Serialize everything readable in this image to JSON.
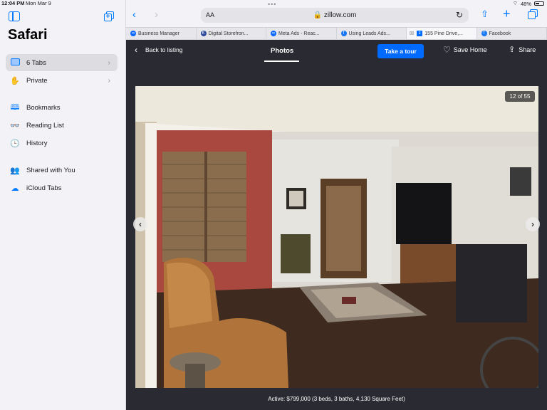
{
  "status": {
    "time": "12:04 PM",
    "date": "Mon Mar 9",
    "battery": "48%"
  },
  "sidebar": {
    "title": "Safari",
    "items": [
      {
        "label": "6 Tabs",
        "icon": "tabs-icon",
        "chevron": "›"
      },
      {
        "label": "Private",
        "icon": "hand-icon",
        "chevron": "›"
      },
      {
        "label": "Bookmarks",
        "icon": "bookmark-icon"
      },
      {
        "label": "Reading List",
        "icon": "glasses-icon"
      },
      {
        "label": "History",
        "icon": "clock-icon"
      },
      {
        "label": "Shared with You",
        "icon": "people-icon"
      },
      {
        "label": "iCloud Tabs",
        "icon": "cloud-icon"
      }
    ]
  },
  "toolbar": {
    "aa": "AA",
    "url": "zillow.com"
  },
  "tabs": [
    {
      "label": "Business Manager",
      "favicon": "meta-icon"
    },
    {
      "label": "Digital Storefron...",
      "favicon": "k-icon"
    },
    {
      "label": "Meta Ads - Reac...",
      "favicon": "meta-icon"
    },
    {
      "label": "Using Leads Ads...",
      "favicon": "facebook-icon"
    },
    {
      "label": "155 Pine Drive,...",
      "favicon": "zillow-icon",
      "active": true
    },
    {
      "label": "Facebook",
      "favicon": "facebook-icon"
    }
  ],
  "listing": {
    "back_label": "Back to listing",
    "photos_label": "Photos",
    "tour_label": "Take a tour",
    "save_label": "Save Home",
    "share_label": "Share",
    "counter": "12 of 55",
    "caption": "Active: $799,000 (3 beds, 3 baths, 4,130 Square Feet)"
  },
  "colors": {
    "accent": "#007aff",
    "zillow_blue": "#006aff",
    "page_dark": "#2a2a32"
  }
}
